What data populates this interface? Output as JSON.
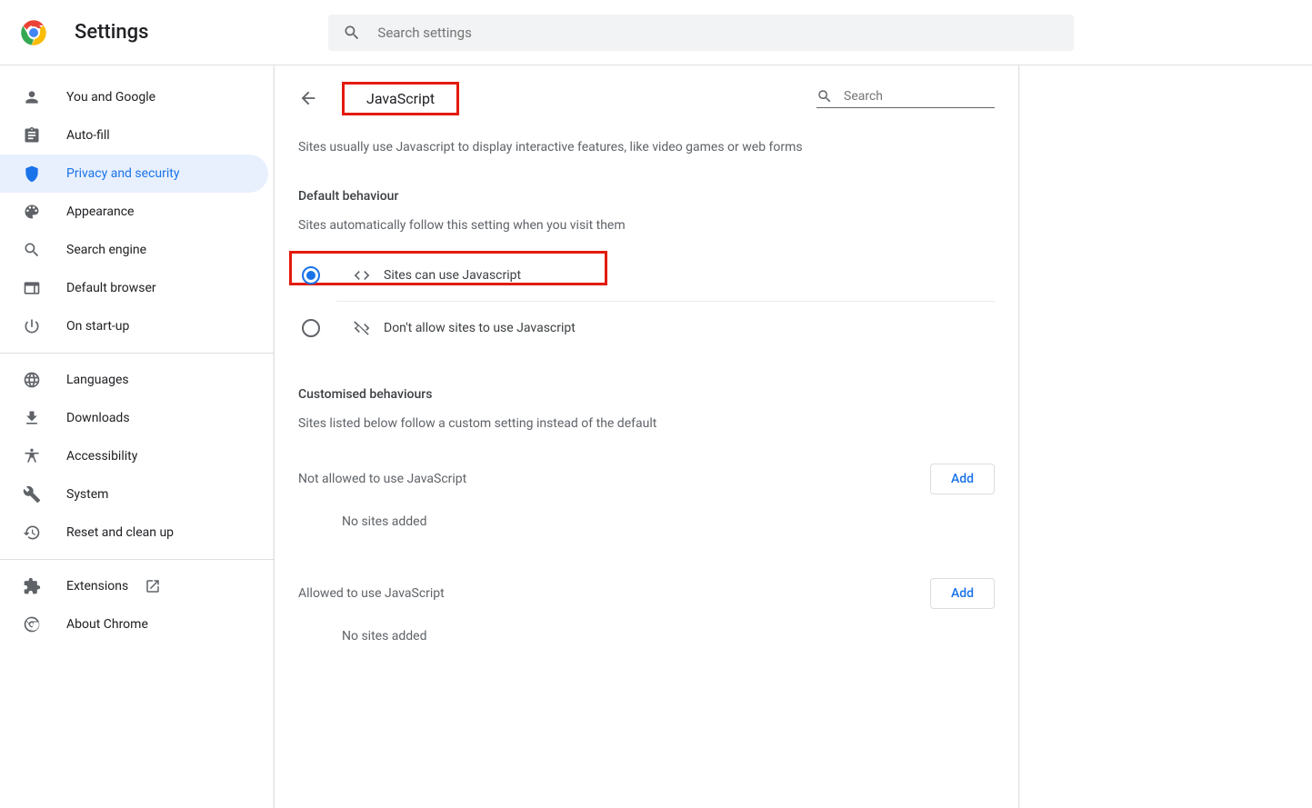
{
  "header": {
    "title": "Settings",
    "search_placeholder": "Search settings"
  },
  "sidebar": {
    "items": [
      {
        "label": "You and Google",
        "icon": "person",
        "active": false
      },
      {
        "label": "Auto-fill",
        "icon": "clipboard",
        "active": false
      },
      {
        "label": "Privacy and security",
        "icon": "shield",
        "active": true
      },
      {
        "label": "Appearance",
        "icon": "palette",
        "active": false
      },
      {
        "label": "Search engine",
        "icon": "search",
        "active": false
      },
      {
        "label": "Default browser",
        "icon": "browser",
        "active": false
      },
      {
        "label": "On start-up",
        "icon": "power",
        "active": false
      }
    ],
    "items2": [
      {
        "label": "Languages",
        "icon": "globe"
      },
      {
        "label": "Downloads",
        "icon": "download"
      },
      {
        "label": "Accessibility",
        "icon": "accessibility"
      },
      {
        "label": "System",
        "icon": "wrench"
      },
      {
        "label": "Reset and clean up",
        "icon": "restore"
      }
    ],
    "items3": [
      {
        "label": "Extensions",
        "icon": "puzzle",
        "external": true
      },
      {
        "label": "About Chrome",
        "icon": "chrome-outline"
      }
    ]
  },
  "main": {
    "page_title": "JavaScript",
    "section_search_placeholder": "Search",
    "description": "Sites usually use Javascript to display interactive features, like video games or web forms",
    "default_behaviour": {
      "header": "Default behaviour",
      "sub": "Sites automatically follow this setting when you visit them",
      "options": [
        {
          "label": "Sites can use Javascript",
          "selected": true,
          "icon": "code"
        },
        {
          "label": "Don't allow sites to use Javascript",
          "selected": false,
          "icon": "code-off"
        }
      ]
    },
    "custom_behaviours": {
      "header": "Customised behaviours",
      "sub": "Sites listed below follow a custom setting instead of the default",
      "sections": [
        {
          "label": "Not allowed to use JavaScript",
          "button": "Add",
          "empty": "No sites added"
        },
        {
          "label": "Allowed to use JavaScript",
          "button": "Add",
          "empty": "No sites added"
        }
      ]
    }
  }
}
